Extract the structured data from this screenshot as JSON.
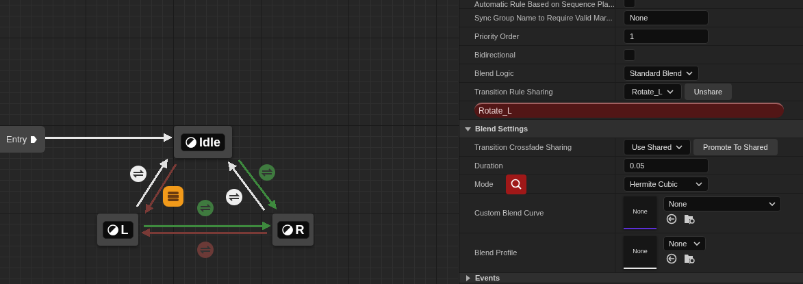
{
  "graph": {
    "entry": {
      "label": "Entry"
    },
    "states": [
      {
        "label": "Idle"
      },
      {
        "label": "L"
      },
      {
        "label": "R"
      }
    ],
    "arrows": [
      {
        "color": "#e8e8e8"
      },
      {
        "color": "#e0e0e0"
      },
      {
        "color": "#7a3a36"
      },
      {
        "color": "#e0e0e0"
      },
      {
        "color": "#3e8a3e"
      },
      {
        "color": "#3e8a3e"
      },
      {
        "color": "#7a3a36"
      }
    ],
    "transitions": [
      {
        "kind": "transition",
        "color": "#eeeeee"
      },
      {
        "kind": "rule",
        "color": "#f29a1a"
      },
      {
        "kind": "transition",
        "color": "#3f7a3f"
      },
      {
        "kind": "transition",
        "color": "#eeeeee"
      },
      {
        "kind": "transition",
        "color": "#3f7a3f"
      },
      {
        "kind": "transition",
        "color": "#6b3a37"
      }
    ]
  },
  "panel": {
    "rows": [
      {
        "kind": "checkbox",
        "label": "Automatic Rule Based on Sequence Pla...",
        "checked": false
      },
      {
        "kind": "text",
        "label": "Sync Group Name to Require Valid Mar...",
        "value": "None"
      },
      {
        "kind": "text",
        "label": "Priority Order",
        "value": "1"
      },
      {
        "kind": "checkbox",
        "label": "Bidirectional",
        "checked": false
      },
      {
        "kind": "dropdown",
        "label": "Blend Logic",
        "value": "Standard Blend"
      },
      {
        "kind": "dropdown-button",
        "label": "Transition Rule Sharing",
        "value": "Rotate_L",
        "button": "Unshare"
      },
      {
        "kind": "name-bar",
        "value": "Rotate_L"
      },
      {
        "kind": "section",
        "label": "Blend Settings",
        "expanded": true
      },
      {
        "kind": "dropdown-button",
        "label": "Transition Crossfade Sharing",
        "value": "Use Shared",
        "button": "Promote To Shared"
      },
      {
        "kind": "text",
        "label": "Duration",
        "value": "0.05"
      },
      {
        "kind": "dropdown",
        "label": "Mode",
        "value": "Hermite Cubic",
        "search_button": true
      },
      {
        "kind": "asset",
        "label": "Custom Blend Curve",
        "thumbnail": "None",
        "value": "None",
        "color": "#5b2fd6"
      },
      {
        "kind": "asset",
        "label": "Blend Profile",
        "thumbnail": "None",
        "value": "None",
        "color": "#e6e6e6"
      },
      {
        "kind": "section",
        "label": "Events",
        "expanded": false
      }
    ]
  }
}
